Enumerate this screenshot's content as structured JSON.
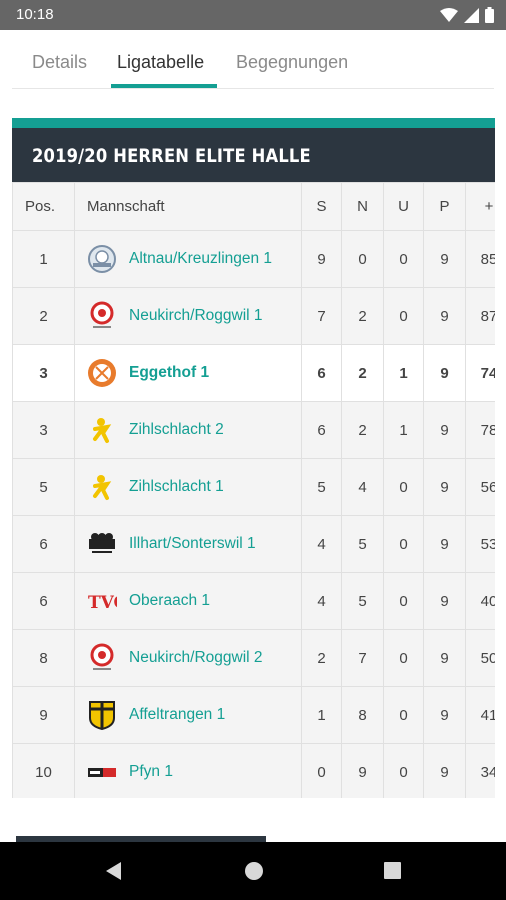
{
  "status_bar": {
    "time": "10:18"
  },
  "tabs": [
    {
      "label": "Details"
    },
    {
      "label": "Ligatabelle"
    },
    {
      "label": "Begegnungen"
    }
  ],
  "league": {
    "title": "2019/20 HERREN ELITE HALLE"
  },
  "table": {
    "headers": {
      "pos": "Pos.",
      "team": "Mannschaft",
      "s": "S",
      "n": "N",
      "u": "U",
      "p": "P",
      "plus": "+"
    },
    "rows": [
      {
        "pos": "1",
        "team": "Altnau/Kreuzlingen 1",
        "s": "9",
        "n": "0",
        "u": "0",
        "p": "9",
        "plus": "85",
        "logo": "altnau-logo"
      },
      {
        "pos": "2",
        "team": "Neukirch/Roggwil 1",
        "s": "7",
        "n": "2",
        "u": "0",
        "p": "9",
        "plus": "87",
        "logo": "neukirch-logo"
      },
      {
        "pos": "3",
        "team": "Eggethof 1",
        "s": "6",
        "n": "2",
        "u": "1",
        "p": "9",
        "plus": "74",
        "logo": "eggethof-logo",
        "highlight": true
      },
      {
        "pos": "3",
        "team": "Zihlschlacht 2",
        "s": "6",
        "n": "2",
        "u": "1",
        "p": "9",
        "plus": "78",
        "logo": "zihlschlacht-logo"
      },
      {
        "pos": "5",
        "team": "Zihlschlacht 1",
        "s": "5",
        "n": "4",
        "u": "0",
        "p": "9",
        "plus": "56",
        "logo": "zihlschlacht-logo"
      },
      {
        "pos": "6",
        "team": "Illhart/Sonterswil 1",
        "s": "4",
        "n": "5",
        "u": "0",
        "p": "9",
        "plus": "53",
        "logo": "illhart-logo"
      },
      {
        "pos": "6",
        "team": "Oberaach 1",
        "s": "4",
        "n": "5",
        "u": "0",
        "p": "9",
        "plus": "40",
        "logo": "oberaach-logo"
      },
      {
        "pos": "8",
        "team": "Neukirch/Roggwil 2",
        "s": "2",
        "n": "7",
        "u": "0",
        "p": "9",
        "plus": "50",
        "logo": "neukirch-logo"
      },
      {
        "pos": "9",
        "team": "Affeltrangen 1",
        "s": "1",
        "n": "8",
        "u": "0",
        "p": "9",
        "plus": "41",
        "logo": "affeltrangen-logo"
      },
      {
        "pos": "10",
        "team": "Pfyn 1",
        "s": "0",
        "n": "9",
        "u": "0",
        "p": "9",
        "plus": "34",
        "logo": "pfyn-logo"
      }
    ]
  },
  "colors": {
    "accent": "#149f93",
    "header_dark": "#2c3640",
    "status_bar": "#666666"
  }
}
